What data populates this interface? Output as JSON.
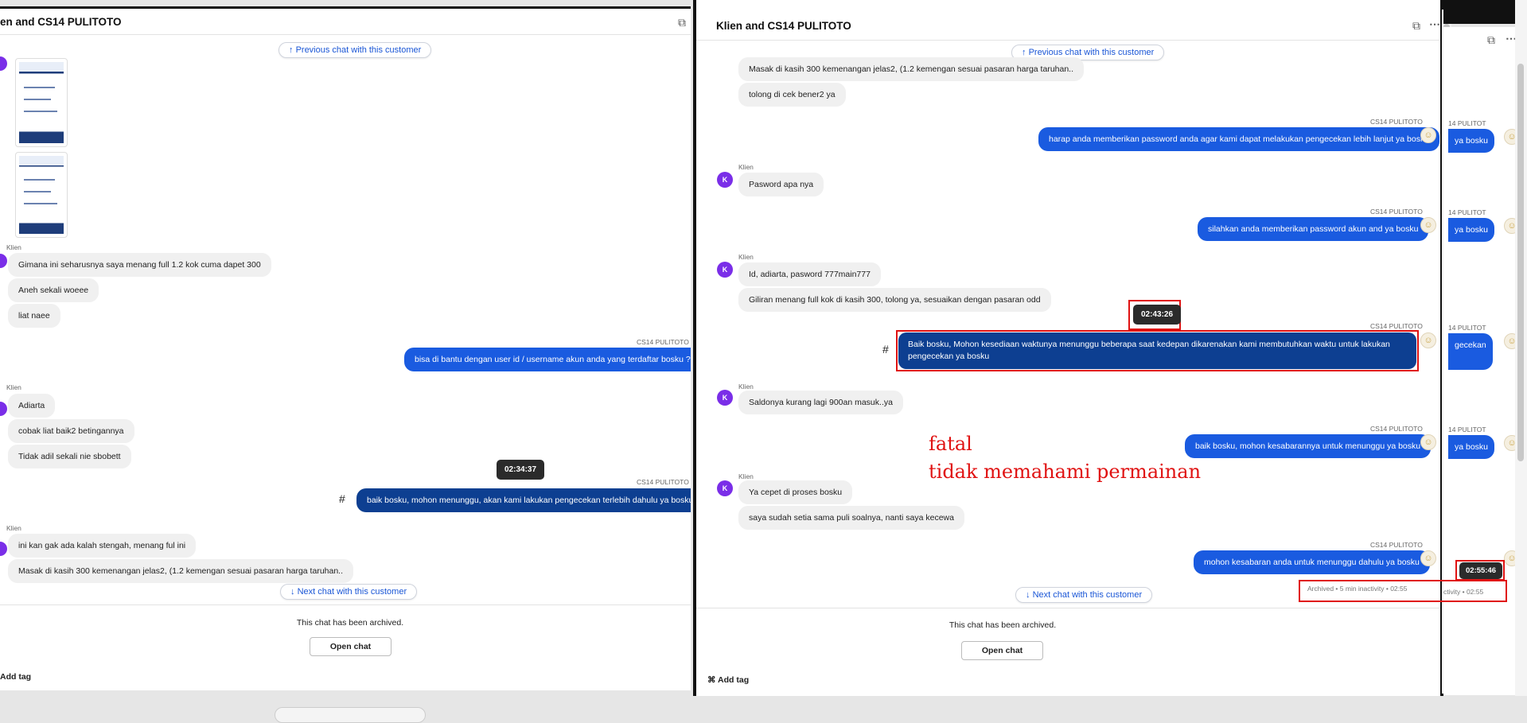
{
  "left": {
    "title": "en and CS14 PULITOTO",
    "prev_chat": "Previous chat with this customer",
    "next_chat": "Next chat with this customer",
    "sender_client": "Klien",
    "sender_agent": "CS14 PULITOTO",
    "msgs": [
      "Gimana ini seharusnya saya menang full 1.2 kok cuma dapet 300",
      "Aneh sekali woeee",
      "liat naee",
      "bisa di bantu dengan user id / username akun anda yang terdaftar bosku ?",
      "Adiarta",
      "cobak liat baik2 betingannya",
      "Tidak adil sekali nie sbobett",
      "baik bosku, mohon menunggu, akan kami lakukan pengecekan terlebih dahulu ya bosku",
      "ini kan gak ada kalah stengah, menang ful ini",
      "Masak di kasih 300 kemenangan jelas2, (1.2 kemengan sesuai pasaran harga taruhan.."
    ],
    "tooltip": "02:34:37",
    "archived": "This chat has been archived.",
    "open_chat": "Open chat",
    "add_tag": "Add tag"
  },
  "right": {
    "title": "Klien and CS14 PULITOTO",
    "prev_chat": "Previous chat with this customer",
    "next_chat": "Next chat with this customer",
    "sender_client": "Klien",
    "sender_agent": "CS14 PULITOTO",
    "avatar_letter": "K",
    "msgs": [
      "Masak di kasih 300 kemenangan jelas2, (1.2 kemengan sesuai pasaran harga taruhan..",
      "tolong di cek bener2 ya",
      "harap anda memberikan password anda agar kami dapat melakukan pengecekan lebih lanjut ya bosku",
      "Pasword apa nya",
      "silahkan anda memberikan password akun and ya bosku",
      "Id, adiarta, pasword 777main777",
      "Giliran menang full kok di kasih 300, tolong ya, sesuaikan dengan pasaran odd",
      "Baik bosku, Mohon kesediaan waktunya menunggu beberapa saat kedepan dikarenakan kami membutuhkan waktu untuk lakukan pengecekan ya bosku",
      "Saldonya kurang lagi 900an masuk..ya",
      "baik bosku, mohon kesabarannya untuk menunggu ya bosku",
      "Ya cepet di proses bosku",
      "saya sudah setia sama puli soalnya, nanti saya kecewa",
      "mohon kesabaran anda untuk menunggu dahulu ya bosku"
    ],
    "tooltip": "02:43:26",
    "tooltip2": "02:55:46",
    "archived_note": "Archived • 5 min inactivity • 02:55",
    "archived_note2": "ctivity • 02:55",
    "archived": "This chat has been archived.",
    "open_chat": "Open chat",
    "add_tag": "Add tag"
  },
  "peek": {
    "bubbles": [
      "ya bosku",
      "ya bosku",
      "gecekan",
      "ya bosku"
    ],
    "sender": "14 PULITOT"
  },
  "annotation": {
    "line1": "fatal",
    "line2": "tidak memahami permainan"
  },
  "colors": {
    "outgoing": "#1a5be0",
    "selected": "#0d3f91",
    "annotation": "#e01212",
    "avatar": "#7a2ee8"
  }
}
